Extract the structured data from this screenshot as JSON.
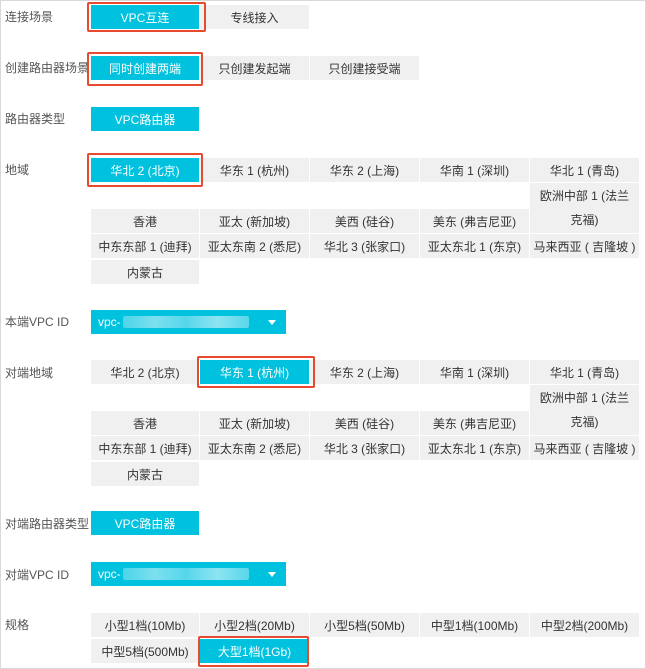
{
  "labels": {
    "scene": "连接场景",
    "router_scene": "创建路由器场景",
    "router_type": "路由器类型",
    "region": "地域",
    "local_vpc": "本端VPC ID",
    "peer_region": "对端地域",
    "peer_router_type": "对端路由器类型",
    "peer_vpc": "对端VPC ID",
    "spec": "规格"
  },
  "scene_options": [
    "VPC互连",
    "专线接入"
  ],
  "router_scene_options": [
    "同时创建两端",
    "只创建发起端",
    "只创建接受端"
  ],
  "router_type_option": "VPC路由器",
  "regions": [
    "华北 2 (北京)",
    "华东 1 (杭州)",
    "华东 2 (上海)",
    "华南 1 (深圳)",
    "华北 1 (青岛)",
    "香港",
    "亚太 (新加坡)",
    "美西 (硅谷)",
    "美东 (弗吉尼亚)",
    "欧洲中部 1 (法兰克福)",
    "中东东部 1 (迪拜)",
    "亚太东南 2 (悉尼)",
    "华北 3 (张家口)",
    "亚太东北 1 (东京)",
    "马来西亚 ( 吉隆坡 )",
    "内蒙古"
  ],
  "local_vpc_value": "vpc-",
  "peer_vpc_value": "vpc-",
  "peer_router_type_option": "VPC路由器",
  "specs": [
    "小型1档(10Mb)",
    "小型2档(20Mb)",
    "小型5档(50Mb)",
    "中型1档(100Mb)",
    "中型2档(200Mb)",
    "中型5档(500Mb)",
    "大型1档(1Gb)"
  ],
  "selected": {
    "scene": "VPC互连",
    "router_scene": "同时创建两端",
    "region": "华北 2 (北京)",
    "peer_region": "华东 1 (杭州)",
    "spec": "大型1档(1Gb)"
  },
  "colors": {
    "accent": "#00c1de",
    "highlight": "#e84a2f",
    "option_bg": "#f0f0f0"
  }
}
